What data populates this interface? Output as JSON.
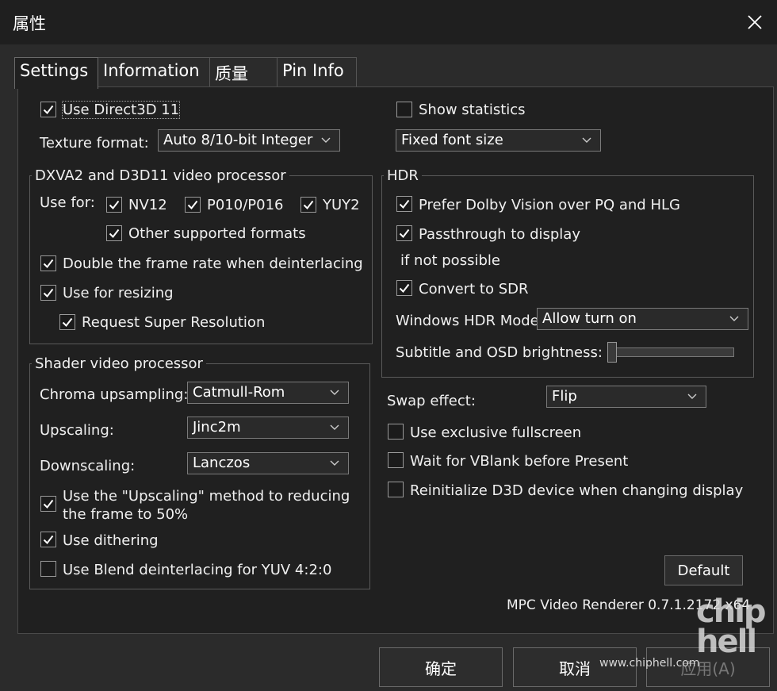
{
  "window": {
    "title": "属性"
  },
  "tabs": [
    {
      "label": "Settings",
      "active": true
    },
    {
      "label": "Information",
      "active": false
    },
    {
      "label": "质量",
      "active": false
    },
    {
      "label": "Pin Info",
      "active": false
    }
  ],
  "settings": {
    "use_d3d11": {
      "label": "Use Direct3D 11",
      "checked": true
    },
    "texture_format": {
      "label": "Texture format:",
      "value": "Auto 8/10-bit Integer"
    },
    "show_statistics": {
      "label": "Show statistics",
      "checked": false
    },
    "font_size": {
      "value": "Fixed font size"
    },
    "dxva": {
      "title": "DXVA2 and D3D11 video processor",
      "use_for_label": "Use for:",
      "nv12": {
        "label": "NV12",
        "checked": true
      },
      "p010": {
        "label": "P010/P016",
        "checked": true
      },
      "yuy2": {
        "label": "YUY2",
        "checked": true
      },
      "other": {
        "label": "Other supported formats",
        "checked": true
      },
      "double_rate": {
        "label": "Double the frame rate when deinterlacing",
        "checked": true
      },
      "resizing": {
        "label": "Use for resizing",
        "checked": true
      },
      "super_res": {
        "label": "Request Super Resolution",
        "checked": true
      }
    },
    "shader": {
      "title": "Shader video processor",
      "chroma": {
        "label": "Chroma upsampling:",
        "value": "Catmull-Rom"
      },
      "upscaling": {
        "label": "Upscaling:",
        "value": "Jinc2m"
      },
      "downscaling": {
        "label": "Downscaling:",
        "value": "Lanczos"
      },
      "upscaling_method": {
        "label_line1": "Use the \"Upscaling\" method to reducing",
        "label_line2": "the frame to 50%",
        "checked": true
      },
      "dithering": {
        "label": "Use dithering",
        "checked": true
      },
      "blend": {
        "label": "Use Blend deinterlacing for YUV 4:2:0",
        "checked": false
      }
    },
    "hdr": {
      "title": "HDR",
      "dolby": {
        "label": "Prefer Dolby Vision over PQ and HLG",
        "checked": true
      },
      "passthrough": {
        "label": "Passthrough to display",
        "checked": true
      },
      "if_not_possible": "if not possible",
      "convert_sdr": {
        "label": "Convert to SDR",
        "checked": true
      },
      "windows_mode": {
        "label": "Windows HDR Mode:",
        "value": "Allow turn on"
      },
      "brightness": {
        "label": "Subtitle and OSD brightness:",
        "level": 0
      }
    },
    "swap": {
      "label": "Swap effect:",
      "value": "Flip"
    },
    "exclusive": {
      "label": "Use exclusive fullscreen",
      "checked": false
    },
    "vblank": {
      "label": "Wait for VBlank before Present",
      "checked": false
    },
    "reinit": {
      "label": "Reinitialize D3D device when changing display",
      "checked": false
    },
    "default_label": "Default",
    "version": "MPC Video Renderer 0.7.1.2172 x64"
  },
  "footer": {
    "ok": "确定",
    "cancel": "取消",
    "apply": "应用(A)"
  },
  "watermark": {
    "url": "www.chiphell.com",
    "logo": "chip hell"
  },
  "colors": {
    "panel": "#202020",
    "titlebar": "#1f1f1f",
    "window": "#2b2b2b"
  }
}
